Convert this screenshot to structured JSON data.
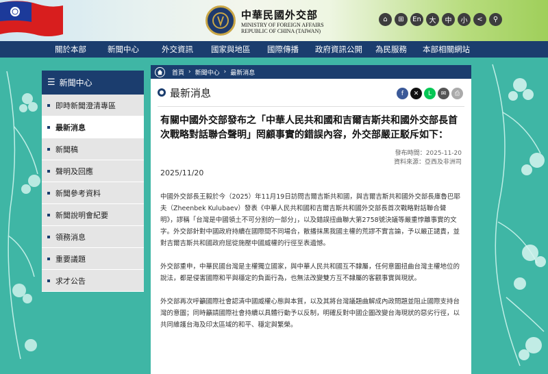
{
  "header": {
    "logo_zh": "中華民國外交部",
    "logo_en_1": "MINISTRY OF FOREIGN AFFAIRS",
    "logo_en_2": "REPUBLIC OF CHINA (TAIWAN)",
    "tools": [
      {
        "icon": "home-icon",
        "label": "⌂"
      },
      {
        "icon": "sitemap-icon",
        "label": "⊞"
      },
      {
        "label": "En"
      },
      {
        "label": "大"
      },
      {
        "label": "中"
      },
      {
        "label": "小"
      },
      {
        "icon": "share-icon",
        "label": "<"
      },
      {
        "icon": "search-icon",
        "label": "⚲"
      }
    ]
  },
  "nav": [
    "關於本部",
    "新聞中心",
    "外交資訊",
    "國家與地區",
    "國際傳播",
    "政府資訊公開",
    "為民服務",
    "本部相關網站"
  ],
  "sidebar": {
    "title": "新聞中心",
    "items": [
      "即時新聞澄清專區",
      "最新消息",
      "新聞稿",
      "聲明及回應",
      "新聞參考資料",
      "新聞說明會紀要",
      "領務消息",
      "重要議題",
      "求才公告"
    ],
    "active_index": 1
  },
  "breadcrumb": [
    "首頁",
    "新聞中心",
    "最新消息"
  ],
  "section_title": "最新消息",
  "share_colors": {
    "facebook": "#3b5998",
    "x": "#111111",
    "line": "#06c755",
    "email": "#555555",
    "print": "#aaaaaa"
  },
  "article": {
    "title": "有關中國外交部發布之「中華人民共和國和吉爾吉斯共和國外交部長首次戰略對話聯合聲明」罔顧事實的錯誤內容，外交部嚴正駁斥如下：",
    "publish_label": "發布時間：",
    "publish_time": "2025-11-20",
    "source_label": "資料來源：",
    "source": "亞西及非洲司",
    "date": "2025/11/20",
    "paragraphs": [
      "中國外交部長王毅於今（2025）年11月19日訪問吉爾吉斯共和國，與吉爾吉斯共和國外交部長庫魯巴耶夫（Zheenbek Kulubaev）發表《中華人民共和國和吉爾吉斯共和國外交部長首次戰略對話聯合聲明》，謬稱「台灣是中國領土不可分割的一部分」，以及錯誤扭曲聯大第2758號決議等嚴重悖離事實的文字。外交部針對中國政府持續在國際間不同場合，散播抹黑我國主權的荒謬不實言論，予以嚴正譴責，並對吉爾吉斯共和國政府屈從施壓中國威權的行徑至表遺憾。",
      "外交部重申，中華民國台灣是主權獨立國家，與中華人民共和國互不隸屬，任何意圖扭曲台灣主權地位的說法，都是侵害國際和平與穩定的負面行為，也無法改變雙方互不隸屬的客觀事實與現狀。",
      "外交部再次呼籲國際社會認清中國威權心態與本質，以及其將台灣議題曲解成內政問題並阻止國際支持台灣的意圖；同時籲請國際社會持續以具體行動予以反制，明確反對中國企圖改變台海現狀的惡劣行徑，以共同維護台海及印太區域的和平、穩定與繁榮。"
    ]
  }
}
